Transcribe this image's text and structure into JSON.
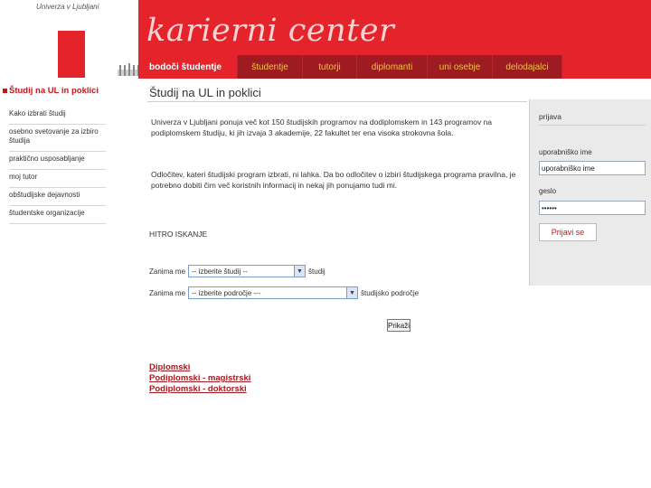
{
  "university": {
    "name": "Univerza v Ljubljani"
  },
  "header": {
    "title": "karierni center"
  },
  "nav": {
    "tabs": [
      {
        "label": "bodoči študentje"
      },
      {
        "label": "študentje"
      },
      {
        "label": "tutorji"
      },
      {
        "label": "diplomanti"
      },
      {
        "label": "uni osebje"
      },
      {
        "label": "delodajalci"
      }
    ]
  },
  "sidebar": {
    "title": "Študij na UL in poklici",
    "items": [
      {
        "label": "Kako izbrati študij"
      },
      {
        "label": "osebno svetovanje za izbiro študija"
      },
      {
        "label": "praktično usposabljanje"
      },
      {
        "label": "moj tutor"
      },
      {
        "label": "obštudijske dejavnosti"
      },
      {
        "label": "študentske organizacije"
      }
    ]
  },
  "main": {
    "title": "Študij na UL in poklici",
    "para1": "Univerza v Ljubljani ponuja več kot 150 študijskih programov na dodiplomskem in 143 programov na podiplomskem študiju, ki jih izvaja 3 akademije, 22 fakultet ter ena visoka strokovna šola.",
    "para2": "Odločitev, kateri študijski program izbrati, ni lahka. Da bo odločitev o izbiri študijskega programa pravilna, je potrebno dobiti čim več koristnih informacij in nekaj jih ponujamo tudi mi.",
    "quick_search": {
      "title": "HITRO ISKANJE",
      "row1": {
        "label": "Zanima me",
        "select_value": "-- izberite študij --",
        "after": "študij"
      },
      "row2": {
        "label": "Zanima me",
        "select_value": "-- izberite področje ---",
        "after": "študijsko področje"
      },
      "show_button": "Prikaži"
    },
    "links": [
      {
        "label": "Diplomski"
      },
      {
        "label": "Podiplomski - magistrski"
      },
      {
        "label": "Podiplomski - doktorski"
      }
    ]
  },
  "login": {
    "title": "prijava",
    "username_label": "uporabniško ime",
    "username_value": "uporabniško ime",
    "password_label": "geslo",
    "password_value": "••••••",
    "button": "Prijavi se"
  },
  "colors": {
    "brand_red": "#e5232a",
    "tab_dark": "#9e1c21",
    "tab_text": "#f0c040"
  }
}
